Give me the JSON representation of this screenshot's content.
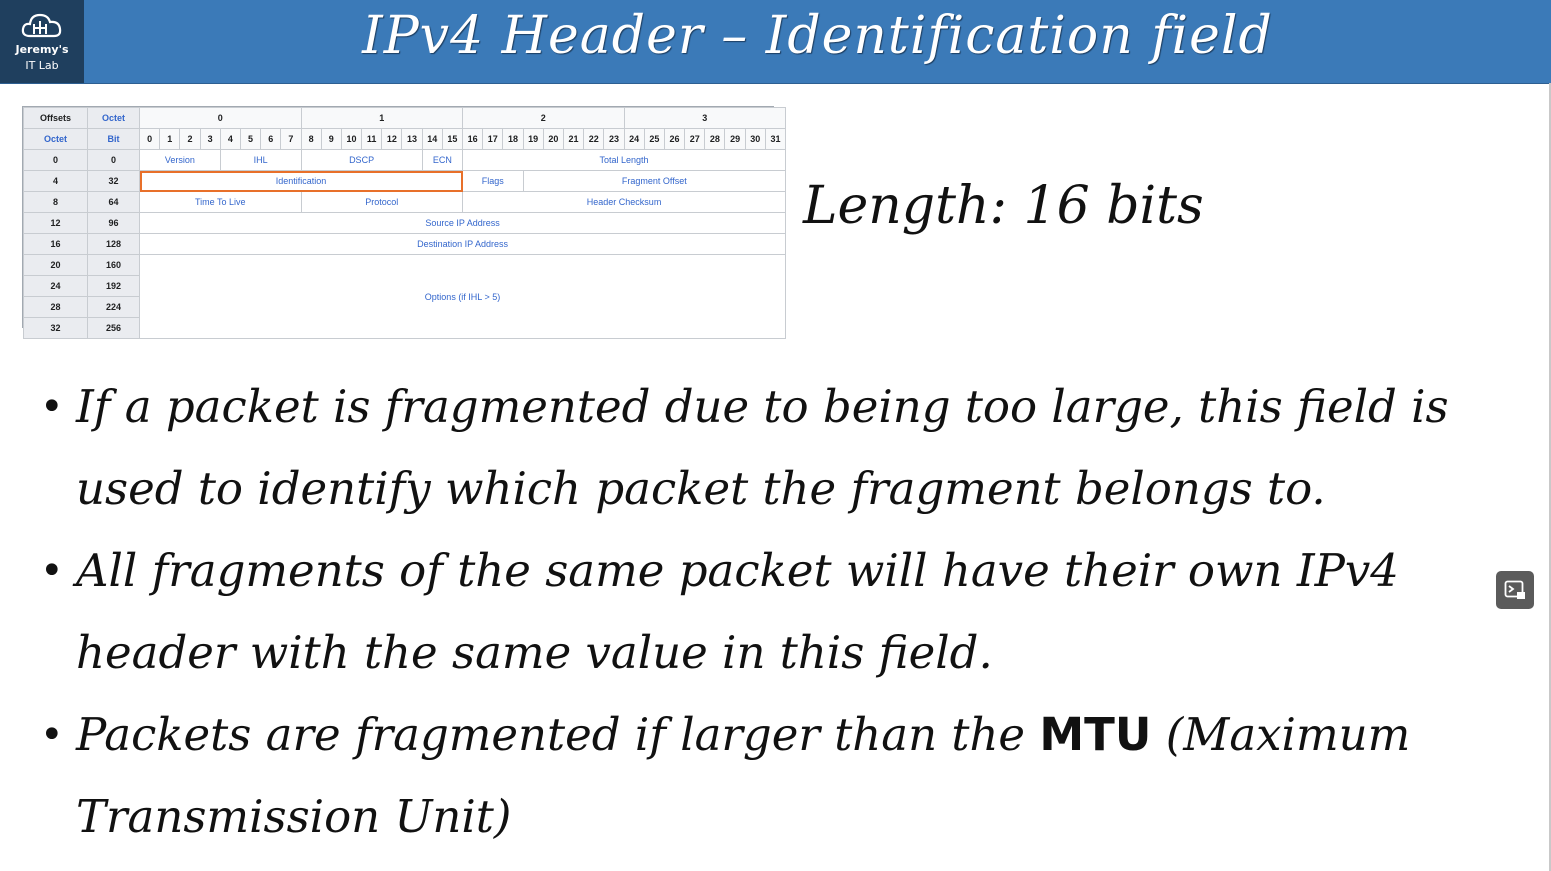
{
  "logo": {
    "line1": "Jeremy's",
    "line2": "IT Lab"
  },
  "title": "IPv4 Header – Identification field",
  "table": {
    "head1": [
      "Offsets",
      "Octet",
      "0",
      "1",
      "2",
      "3"
    ],
    "head2": [
      "Octet",
      "Bit"
    ],
    "bits": [
      "0",
      "1",
      "2",
      "3",
      "4",
      "5",
      "6",
      "7",
      "8",
      "9",
      "10",
      "11",
      "12",
      "13",
      "14",
      "15",
      "16",
      "17",
      "18",
      "19",
      "20",
      "21",
      "22",
      "23",
      "24",
      "25",
      "26",
      "27",
      "28",
      "29",
      "30",
      "31"
    ],
    "rows": [
      {
        "octet": "0",
        "bit": "0"
      },
      {
        "octet": "4",
        "bit": "32"
      },
      {
        "octet": "8",
        "bit": "64"
      },
      {
        "octet": "12",
        "bit": "96"
      },
      {
        "octet": "16",
        "bit": "128"
      },
      {
        "octet": "20",
        "bit": "160"
      },
      {
        "octet": "24",
        "bit": "192"
      },
      {
        "octet": "28",
        "bit": "224"
      },
      {
        "octet": "32",
        "bit": "256"
      }
    ],
    "fields": {
      "version": "Version",
      "ihl": "IHL",
      "dscp": "DSCP",
      "ecn": "ECN",
      "total_length": "Total Length",
      "identification": "Identification",
      "flags": "Flags",
      "fragment_offset": "Fragment Offset",
      "ttl": "Time To Live",
      "protocol": "Protocol",
      "checksum": "Header Checksum",
      "src": "Source IP Address",
      "dst": "Destination IP Address",
      "options": "Options (if IHL > 5)"
    },
    "highlight_color": "#e8702a"
  },
  "length_text": "Length: 16 bits",
  "bullets": [
    {
      "text": "If a packet is fragmented due to being too large, this field is used to identify which packet the fragment belongs to."
    },
    {
      "text": "All fragments of the same packet will have their own IPv4 header with the same value in this field."
    },
    {
      "pre": "Packets are fragmented if larger than the ",
      "bold": "MTU",
      "post": " (Maximum Transmission Unit)"
    }
  ],
  "colors": {
    "header_bar": "#3b7ab8",
    "logo_bg": "#1f3f5e"
  }
}
